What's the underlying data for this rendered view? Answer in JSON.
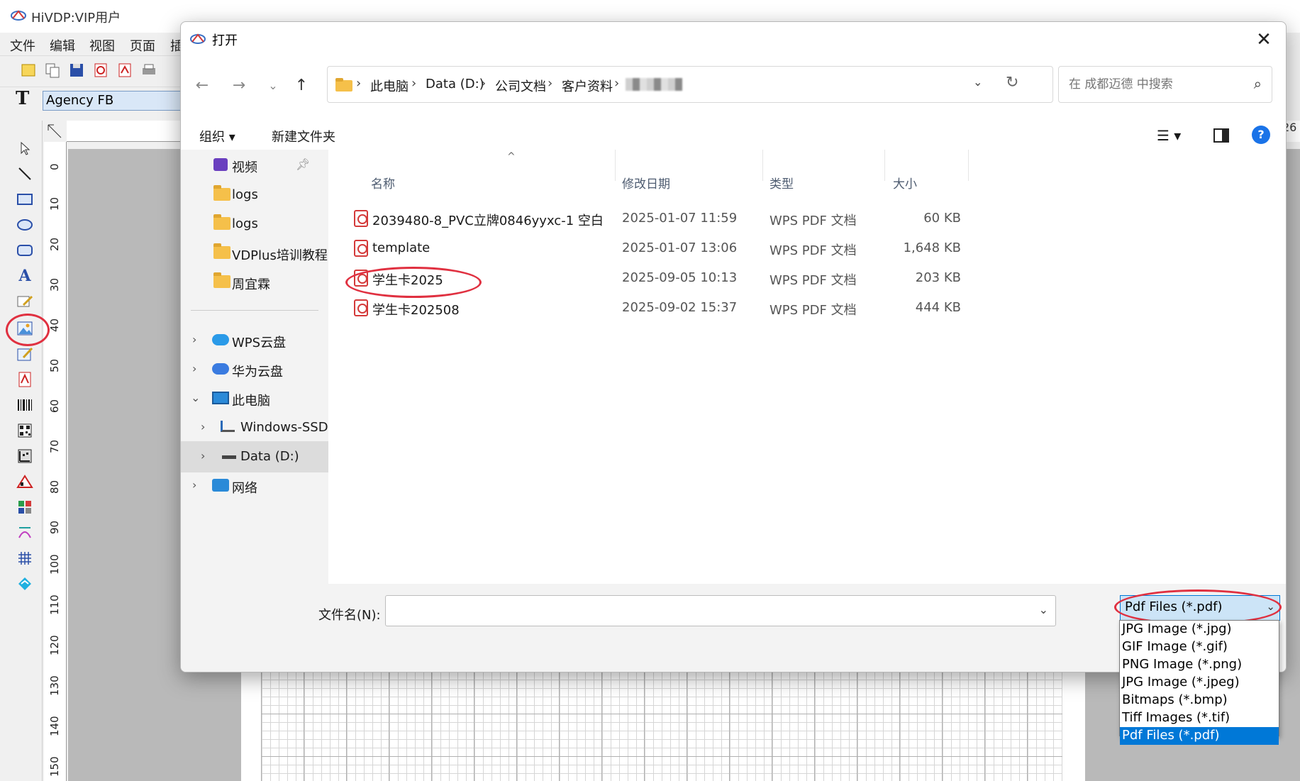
{
  "app": {
    "title": "HiVDP:VIP用户",
    "menu": [
      "文件",
      "编辑",
      "视图",
      "页面",
      "插"
    ],
    "font_name": "Agency FB",
    "ruler_ticks": [
      "0",
      "10",
      "20",
      "30",
      "40",
      "50",
      "60",
      "70",
      "80",
      "90",
      "100",
      "110",
      "120",
      "130",
      "140",
      "150"
    ],
    "ruler_right": "26"
  },
  "dialog": {
    "title": "打开",
    "close": "✕",
    "breadcrumb": [
      "此电脑",
      "Data (D:)",
      "公司文档",
      "客户资料"
    ],
    "search_placeholder": "在 成都迈德 中搜索",
    "commands": {
      "organize": "组织 ▾",
      "new_folder": "新建文件夹"
    },
    "nav": [
      {
        "label": "视频",
        "pinned": true
      },
      {
        "label": "logs"
      },
      {
        "label": "logs"
      },
      {
        "label": "VDPlus培训教程"
      },
      {
        "label": "周宜霖"
      },
      {
        "label": "WPS云盘"
      },
      {
        "label": "华为云盘"
      },
      {
        "label": "此电脑"
      },
      {
        "label": "Windows-SSD"
      },
      {
        "label": "Data (D:)"
      },
      {
        "label": "网络"
      }
    ],
    "columns": {
      "name": "名称",
      "date": "修改日期",
      "type": "类型",
      "size": "大小"
    },
    "files": [
      {
        "name": "2039480-8_PVC立牌0846yyxc-1  空白",
        "date": "2025-01-07 11:59",
        "type": "WPS PDF 文档",
        "size": "60 KB"
      },
      {
        "name": "template",
        "date": "2025-01-07 13:06",
        "type": "WPS PDF 文档",
        "size": "1,648 KB"
      },
      {
        "name": "学生卡2025",
        "date": "2025-09-05 10:13",
        "type": "WPS PDF 文档",
        "size": "203 KB"
      },
      {
        "name": "学生卡202508",
        "date": "2025-09-02 15:37",
        "type": "WPS PDF 文档",
        "size": "444 KB"
      }
    ],
    "filename_label": "文件名(N):",
    "filename_value": "",
    "filter_selected": "Pdf Files (*.pdf)",
    "filter_options": [
      "JPG Image (*.jpg)",
      "GIF Image (*.gif)",
      "PNG Image (*.png)",
      "JPG Image (*.jpeg)",
      "Bitmaps (*.bmp)",
      "Tiff Images (*.tif)",
      "Pdf Files (*.pdf)"
    ]
  },
  "colors": {
    "accent": "#0078d7",
    "annotation": "#e03040",
    "folder": "#f5c04a"
  }
}
